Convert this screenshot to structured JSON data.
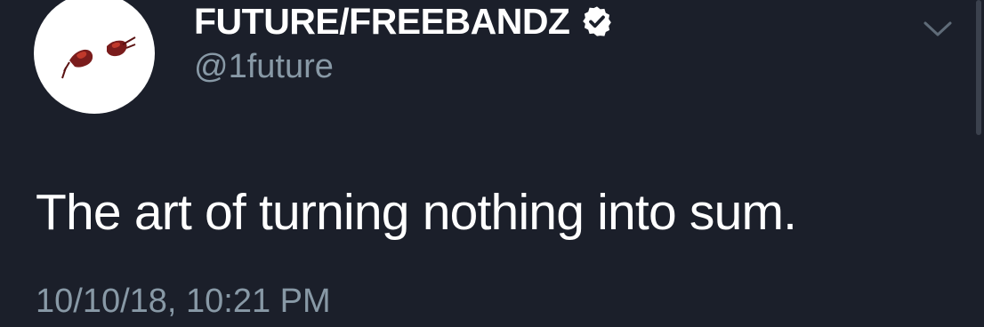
{
  "tweet": {
    "author": {
      "display_name": "FUTURE/FREEBANDZ",
      "handle": "@1future",
      "verified": true,
      "avatar_icon": "avatar-image"
    },
    "text": "The art of turning nothing into sum.",
    "timestamp": "10/10/18, 10:21 PM",
    "menu_icon": "chevron-down-icon"
  },
  "colors": {
    "background": "#1b1f2a",
    "primary_text": "#ffffff",
    "secondary_text": "#8899a6",
    "verified_badge": "#ffffff"
  }
}
